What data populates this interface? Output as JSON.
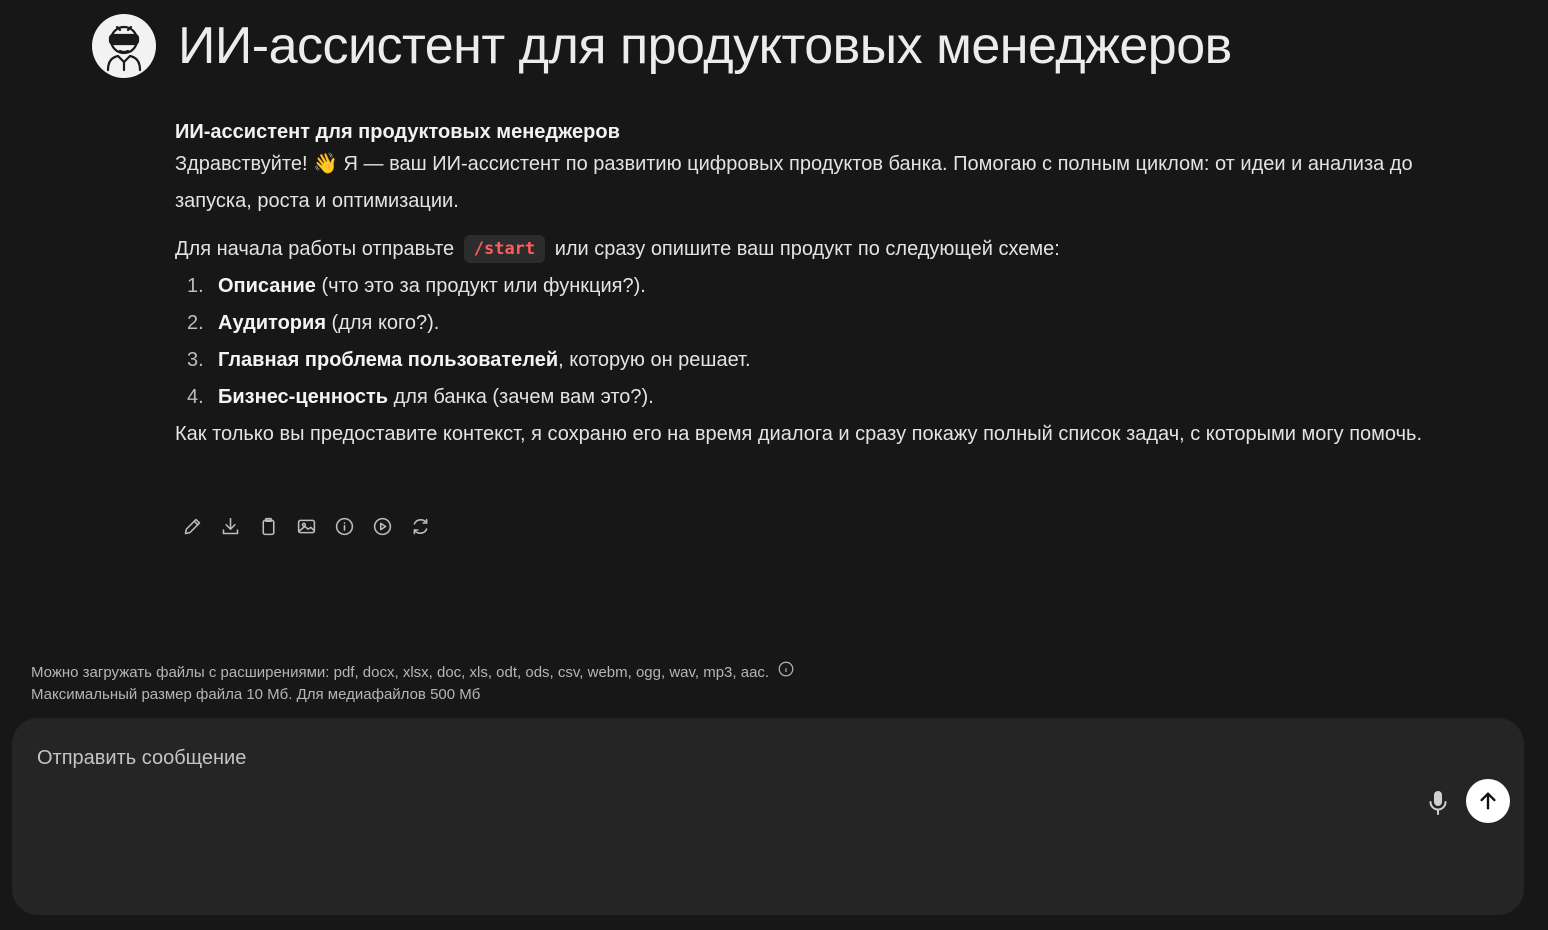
{
  "header": {
    "title": "ИИ-ассистент для продуктовых менеджеров",
    "avatar_icon": "robot-glasses-icon"
  },
  "message": {
    "heading": "ИИ-ассистент для продуктовых менеджеров",
    "greeting": "Здравствуйте! 👋 Я — ваш ИИ-ассистент по развитию цифровых продуктов банка. Помогаю с полным циклом: от идеи и анализа до запуска, роста и оптимизации.",
    "intro_before": "Для начала работы отправьте",
    "command": "/start",
    "intro_after": "или сразу опишите ваш продукт по следующей схеме:",
    "steps": [
      {
        "num": "1.",
        "bold": "Описание",
        "rest": " (что это за продукт или функция?)."
      },
      {
        "num": "2.",
        "bold": "Аудитория",
        "rest": " (для кого?)."
      },
      {
        "num": "3.",
        "bold": "Главная проблема пользователей",
        "rest": ", которую он решает."
      },
      {
        "num": "4.",
        "bold": "Бизнес-ценность",
        "rest": " для банка (зачем вам это?)."
      }
    ],
    "closing": "Как только вы предоставите контекст, я сохраню его на время диалога и сразу покажу полный список задач, с которыми могу помочь."
  },
  "actions": [
    "pencil-icon",
    "download-icon",
    "clipboard-icon",
    "image-icon",
    "info-icon",
    "play-icon",
    "refresh-icon"
  ],
  "upload_hint": {
    "line1": "Можно загружать файлы с расширениями: pdf, docx, xlsx, doc, xls, odt, ods, csv, webm, ogg, wav, mp3, aac.",
    "line2": "Максимальный размер файла 10 Мб. Для медиафайлов 500 Мб"
  },
  "composer": {
    "placeholder": "Отправить сообщение"
  },
  "colors": {
    "background": "#171717",
    "composer": "#252525",
    "command": "#ff5c5c"
  }
}
